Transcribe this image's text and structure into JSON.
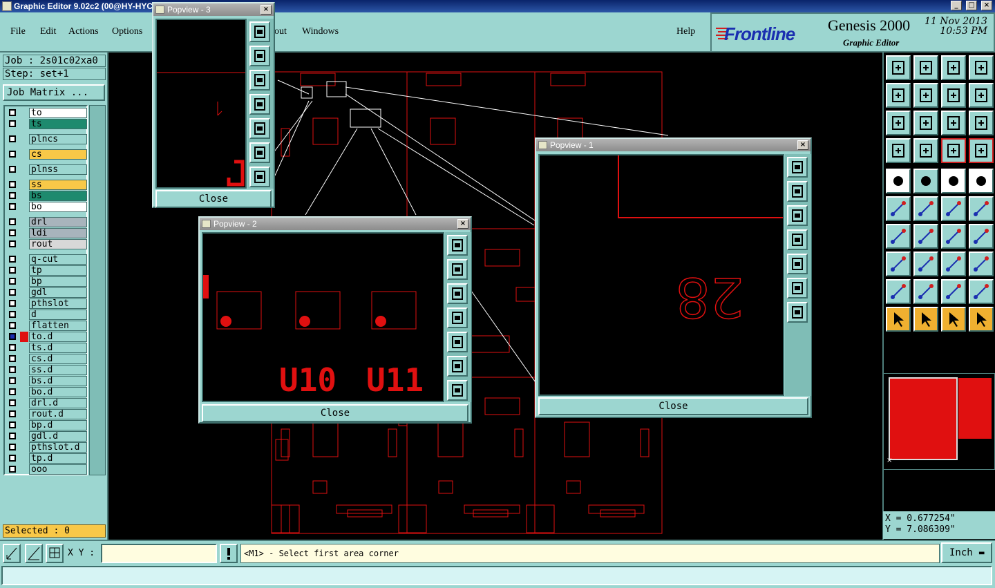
{
  "window": {
    "title": "Graphic Editor 9.02c2 (00@HY-HYCA"
  },
  "menu": {
    "items": [
      "File",
      "Edit",
      "Actions",
      "Options",
      "out",
      "Windows",
      "Help"
    ]
  },
  "brand": {
    "logo": "Frontline",
    "product": "Genesis 2000",
    "subtitle": "Graphic Editor",
    "date": "11 Nov 2013",
    "time": "10:53 PM"
  },
  "job": {
    "job_line": "Job : 2s01c02xa0",
    "step_line": "Step: set+1",
    "matrix_button": "Job Matrix ..."
  },
  "layers": [
    {
      "name": "to",
      "color": "#ffffff"
    },
    {
      "name": "ts",
      "color": "#1e8a6e"
    },
    {
      "name": "plncs",
      "color": "#9cd6d0"
    },
    {
      "name": "cs",
      "color": "#f8c848"
    },
    {
      "name": "plnss",
      "color": "#9cd6d0"
    },
    {
      "name": "ss",
      "color": "#f8c848"
    },
    {
      "name": "bs",
      "color": "#1e8a6e"
    },
    {
      "name": "bo",
      "color": "#ffffff"
    },
    {
      "name": "drl",
      "color": "#a8b4bc"
    },
    {
      "name": "ldi",
      "color": "#a8b4bc"
    },
    {
      "name": "rout",
      "color": "#d8d8d8"
    },
    {
      "name": "q-cut",
      "color": "#9cd6d0"
    },
    {
      "name": "tp",
      "color": "#9cd6d0"
    },
    {
      "name": "bp",
      "color": "#9cd6d0"
    },
    {
      "name": "gdl",
      "color": "#9cd6d0"
    },
    {
      "name": "pthslot",
      "color": "#9cd6d0"
    },
    {
      "name": "d",
      "color": "#9cd6d0"
    },
    {
      "name": "flatten",
      "color": "#9cd6d0"
    },
    {
      "name": "to.d",
      "color": "#9cd6d0"
    },
    {
      "name": "ts.d",
      "color": "#9cd6d0"
    },
    {
      "name": "cs.d",
      "color": "#9cd6d0"
    },
    {
      "name": "ss.d",
      "color": "#9cd6d0"
    },
    {
      "name": "bs.d",
      "color": "#9cd6d0"
    },
    {
      "name": "bo.d",
      "color": "#9cd6d0"
    },
    {
      "name": "drl.d",
      "color": "#9cd6d0"
    },
    {
      "name": "rout.d",
      "color": "#9cd6d0"
    },
    {
      "name": "bp.d",
      "color": "#9cd6d0"
    },
    {
      "name": "gdl.d",
      "color": "#9cd6d0"
    },
    {
      "name": "pthslot.d",
      "color": "#9cd6d0"
    },
    {
      "name": "tp.d",
      "color": "#9cd6d0"
    },
    {
      "name": "ooo",
      "color": "#9cd6d0"
    }
  ],
  "selected": "Selected : 0",
  "popups": {
    "p1": {
      "title": "Popview - 1",
      "close": "Close",
      "text": "28"
    },
    "p2": {
      "title": "Popview - 2",
      "close": "Close",
      "labels": [
        "U10",
        "U11"
      ]
    },
    "p3": {
      "title": "Popview - 3",
      "close": "Close"
    }
  },
  "coords": {
    "x": "X = 0.677254\"",
    "y": "Y = 7.086309\""
  },
  "bottom": {
    "xy_label": "X Y :",
    "xy_value": "",
    "message": "<M1> - Select first area corner",
    "unit": "Inch"
  },
  "colors": {
    "panel": "#9cd6d0",
    "accent_red": "#e01010"
  }
}
